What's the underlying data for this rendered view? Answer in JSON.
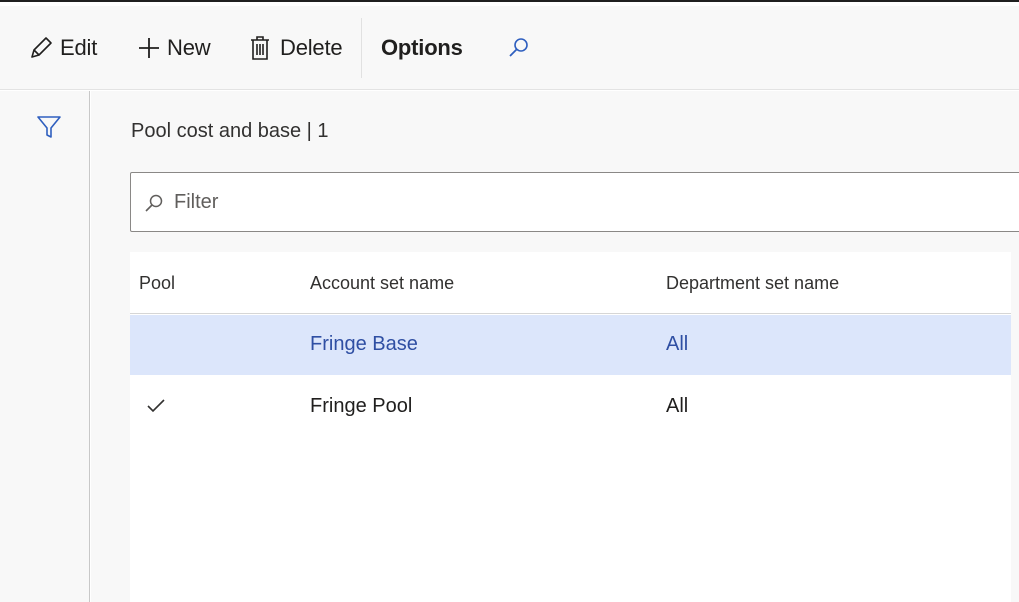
{
  "toolbar": {
    "edit_label": "Edit",
    "new_label": "New",
    "delete_label": "Delete",
    "options_label": "Options"
  },
  "page": {
    "title": "Pool cost and base  |  1"
  },
  "filter": {
    "placeholder": "Filter"
  },
  "grid": {
    "columns": [
      "Pool",
      "Account set name",
      "Department set name"
    ],
    "rows": [
      {
        "pool_checked": false,
        "account_set_name": "Fringe Base",
        "department_set_name": "All",
        "selected": true
      },
      {
        "pool_checked": true,
        "account_set_name": "Fringe Pool",
        "department_set_name": "All",
        "selected": false
      }
    ]
  },
  "icons": {
    "edit": "pencil-icon",
    "new": "plus-icon",
    "delete": "trash-icon",
    "search": "search-icon",
    "filter": "funnel-icon",
    "check": "checkmark-icon"
  },
  "colors": {
    "accent": "#2f4fa3",
    "selected_row": "#dce6fb",
    "toolbar_bg": "#f8f8f8"
  }
}
